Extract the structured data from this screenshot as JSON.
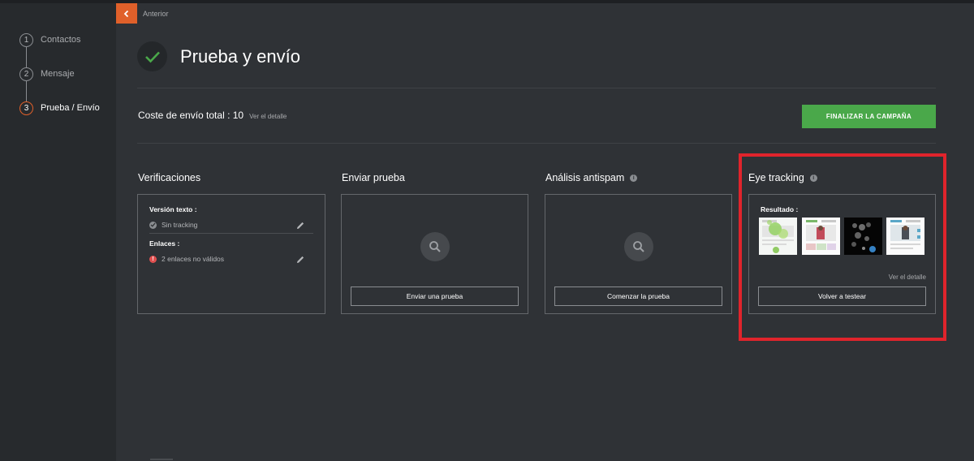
{
  "nav": {
    "back_label": "Anterior",
    "steps": [
      {
        "num": "1",
        "label": "Contactos"
      },
      {
        "num": "2",
        "label": "Mensaje"
      },
      {
        "num": "3",
        "label": "Prueba / Envío"
      }
    ]
  },
  "header": {
    "title": "Prueba y envío"
  },
  "cost": {
    "label": "Coste de envío total : 10",
    "detail_link": "Ver el detalle",
    "finalize_button": "FINALIZAR LA CAMPAÑA"
  },
  "sections": {
    "verificaciones": {
      "title": "Verificaciones",
      "text_version_heading": "Versión texto :",
      "text_version_value": "Sin tracking",
      "links_heading": "Enlaces :",
      "links_value": "2 enlaces no válidos"
    },
    "enviar": {
      "title": "Enviar prueba",
      "button": "Enviar una prueba"
    },
    "antispam": {
      "title": "Análisis antispam",
      "button": "Comenzar la prueba"
    },
    "eye_tracking": {
      "title": "Eye tracking",
      "result_label": "Resultado :",
      "detail_link": "Ver el detalle",
      "button": "Volver a testear"
    }
  },
  "colors": {
    "accent_orange": "#e0602a",
    "success_green": "#4aa84a",
    "highlight_red": "#e0242c",
    "error_red": "#e05050"
  }
}
